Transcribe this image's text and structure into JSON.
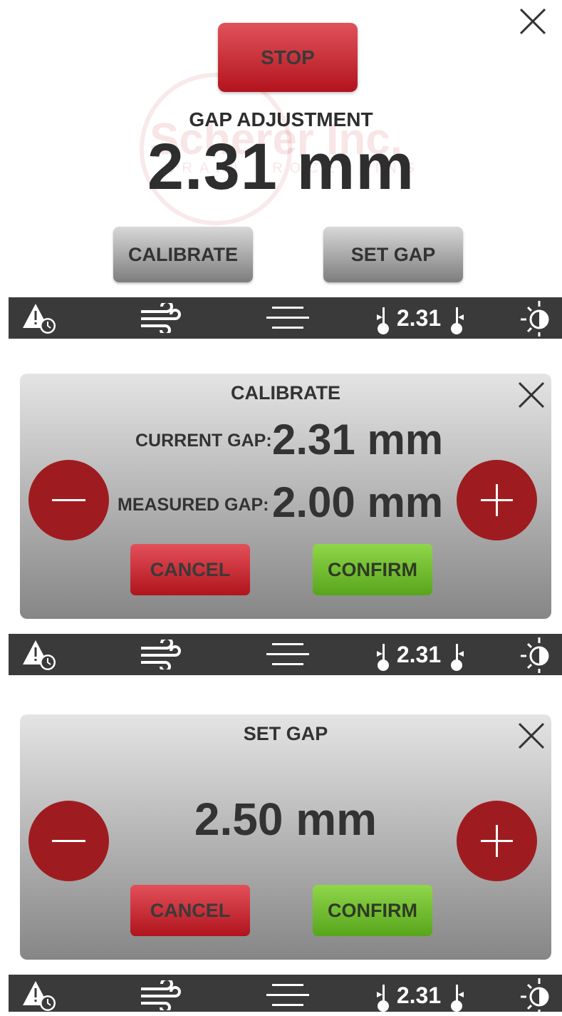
{
  "main": {
    "stop_label": "STOP",
    "title": "GAP ADJUSTMENT",
    "gap_value": "2.31 mm",
    "calibrate_label": "CALIBRATE",
    "set_gap_label": "SET GAP",
    "watermark_logo": "Scherer Inc.",
    "watermark_tagline": "GRAIN PROCESSING"
  },
  "statusbar": {
    "gap_value": "2.31",
    "icons": [
      "alarm-clock-warning-icon",
      "air-flow-icon",
      "menu-lines-icon",
      "gap-roll-icon",
      "brightness-icon"
    ]
  },
  "calibrate_dialog": {
    "title": "CALIBRATE",
    "current_gap_label": "CURRENT GAP:",
    "current_gap_value": "2.31 mm",
    "measured_gap_label": "MEASURED GAP:",
    "measured_gap_value": "2.00 mm",
    "cancel_label": "CANCEL",
    "confirm_label": "CONFIRM"
  },
  "set_gap_dialog": {
    "title": "SET GAP",
    "gap_value": "2.50 mm",
    "cancel_label": "CANCEL",
    "confirm_label": "CONFIRM"
  },
  "colors": {
    "stop_red": "#c0202a",
    "circle_red": "#9e1c20",
    "confirm_green": "#72be32",
    "statusbar_bg": "#3a3a3a"
  }
}
